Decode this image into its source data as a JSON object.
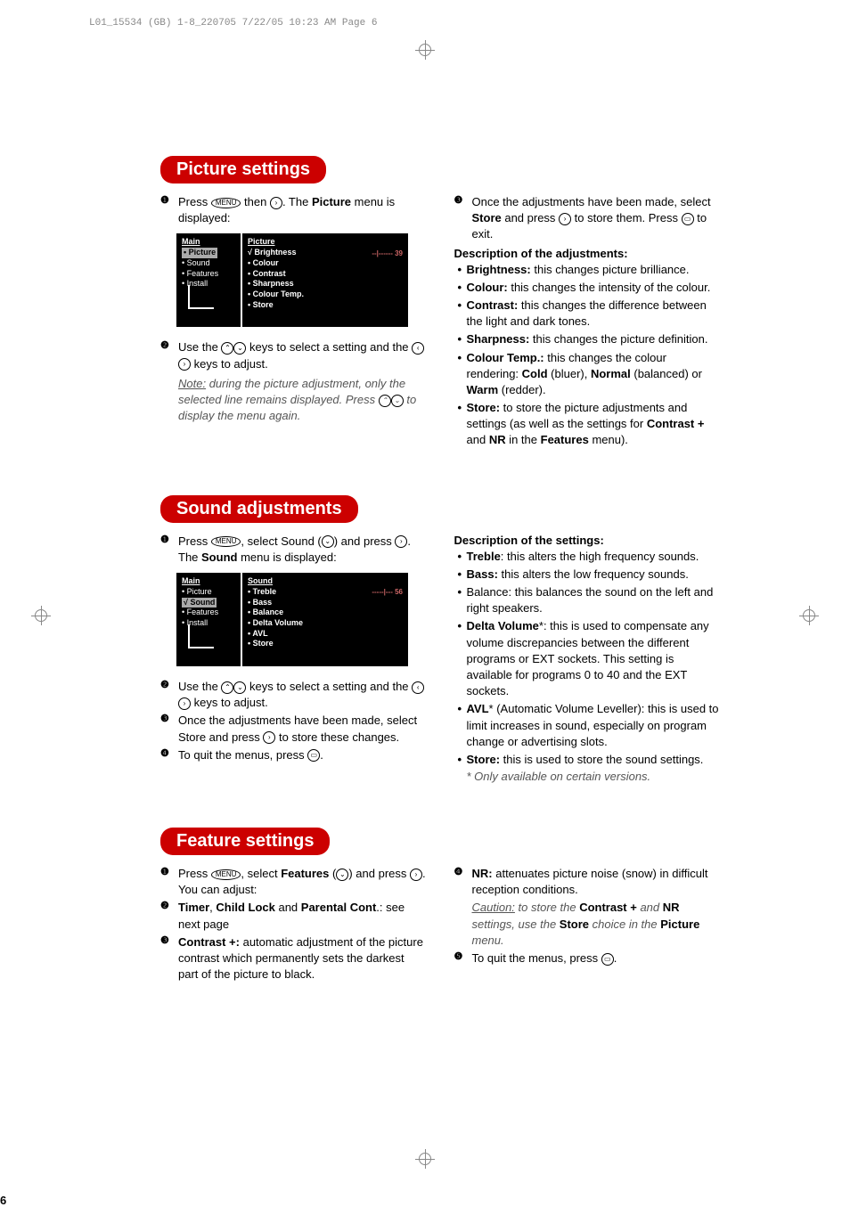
{
  "header": "L01_15534 (GB) 1-8_220705  7/22/05  10:23 AM  Page 6",
  "page_number": "6",
  "sections": {
    "picture": {
      "title": "Picture settings",
      "left": {
        "step1_a": "Press ",
        "step1_b": " then ",
        "step1_c": ". The ",
        "step1_d": "Picture",
        "step1_e": " menu is displayed:",
        "osd": {
          "main_title": "Main",
          "main_items": [
            "• Picture",
            "• Sound",
            "• Features",
            "• Install"
          ],
          "main_hl": 0,
          "sub_title": "Picture",
          "sub_first": "√ Brightness",
          "slider": "--|------  39",
          "sub_items": [
            "• Colour",
            "• Contrast",
            "• Sharpness",
            "• Colour Temp.",
            "• Store"
          ]
        },
        "step2_a": "Use the ",
        "step2_b": " keys to select a setting and the ",
        "step2_c": " keys to adjust.",
        "note_a": "Note:",
        "note_b": " during the picture adjustment, only the selected line remains displayed. Press ",
        "note_c": " to display the menu again."
      },
      "right": {
        "step3_a": "Once the adjustments have been made, select ",
        "step3_b": "Store",
        "step3_c": " and press ",
        "step3_d": " to store them. Press ",
        "step3_e": " to exit.",
        "desc_title": "Description of the adjustments:",
        "bullets": [
          {
            "b": "Brightness:",
            "t": " this changes picture brilliance."
          },
          {
            "b": "Colour:",
            "t": " this changes the intensity of the colour."
          },
          {
            "b": "Contrast:",
            "t": " this changes the difference between the light and dark tones."
          },
          {
            "b": "Sharpness:",
            "t": " this changes the picture definition."
          }
        ],
        "colour_temp_b": "Colour Temp.:",
        "colour_temp_t": " this changes the colour rendering: ",
        "cold": "Cold",
        "cold_t": " (bluer), ",
        "normal": "Normal",
        "normal_t": " (balanced) or ",
        "warm": "Warm",
        "warm_t": " (redder).",
        "store_b": "Store:",
        "store_t": " to store the picture adjustments and settings (as well as the settings for ",
        "contrast_plus": "Contrast +",
        "store_t2": " and ",
        "nr": "NR",
        "store_t3": " in the ",
        "features": "Features",
        "store_t4": " menu)."
      }
    },
    "sound": {
      "title": "Sound adjustments",
      "left": {
        "step1_a": "Press ",
        "step1_b": ", select Sound (",
        "step1_c": ") and press ",
        "step1_d": ". The ",
        "step1_e": "Sound",
        "step1_f": " menu is displayed:",
        "osd": {
          "main_title": "Main",
          "main_items": [
            "• Picture",
            "√ Sound",
            "• Features",
            "• Install"
          ],
          "main_hl": 1,
          "sub_title": "Sound",
          "sub_first": "• Treble",
          "slider": "-----|---  56",
          "sub_items": [
            "• Bass",
            "• Balance",
            "• Delta Volume",
            "• AVL",
            "• Store"
          ]
        },
        "step2_a": "Use the ",
        "step2_b": " keys to select a setting and the ",
        "step2_c": " keys to adjust.",
        "step3": "Once the adjustments have been made, select Store and press ",
        "step3_b": " to store these changes.",
        "step4": "To quit the menus, press ",
        "step4_b": "."
      },
      "right": {
        "desc_title": "Description of the settings:",
        "treble_b": "Treble",
        "treble_t": ": this alters the high frequency sounds.",
        "bass_b": "Bass:",
        "bass_t": " this alters the low frequency sounds.",
        "balance": "Balance: this balances the sound on the left and right speakers.",
        "delta_b": "Delta Volume",
        "delta_t": "*: this is used to compensate any volume discrepancies between the different programs or EXT sockets. This setting is available for programs 0 to 40 and the EXT sockets.",
        "avl_b": "AVL",
        "avl_t": "* (Automatic Volume Leveller): this is used to limit increases in sound, especially on program change or advertising slots.",
        "store_b": "Store:",
        "store_t": " this is used to store the sound settings.",
        "footnote": "* Only available on certain versions."
      }
    },
    "feature": {
      "title": "Feature settings",
      "left": {
        "step1_a": "Press ",
        "step1_b": ", select ",
        "step1_c": "Features",
        "step1_d": " (",
        "step1_e": ") and press ",
        "step1_f": ". You can adjust:",
        "step2_a": "Timer",
        "step2_b": ", ",
        "step2_c": "Child Lock",
        "step2_d": " and ",
        "step2_e": "Parental Cont",
        "step2_f": ".: see next page",
        "step3_a": "Contrast +:",
        "step3_b": " automatic adjustment of the picture contrast which permanently sets the darkest part of the picture to black."
      },
      "right": {
        "step4_a": "NR:",
        "step4_b": " attenuates picture noise (snow) in difficult reception conditions.",
        "caution_a": "Caution:",
        "caution_b": " to store the ",
        "caution_c": "Contrast +",
        "caution_d": " and ",
        "caution_e": "NR",
        "caution_f": " settings, use the ",
        "caution_g": "Store",
        "caution_h": " choice in the ",
        "caution_i": "Picture",
        "caution_j": " menu.",
        "step5_a": "To quit the menus, press ",
        "step5_b": "."
      }
    }
  }
}
